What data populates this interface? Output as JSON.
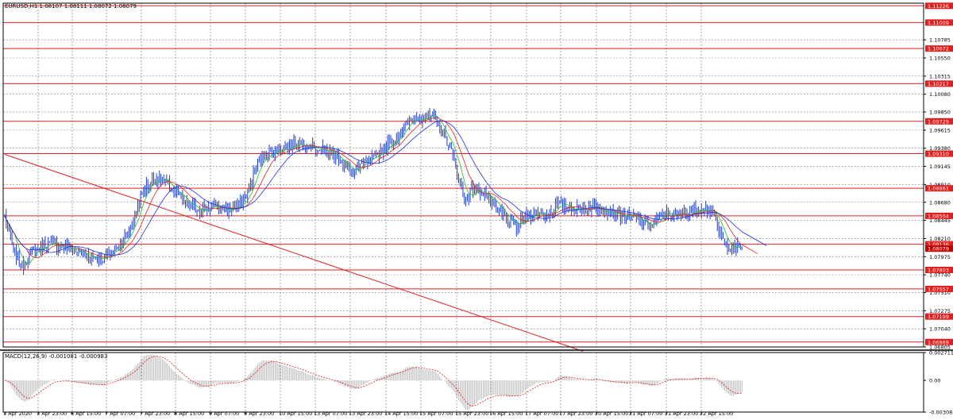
{
  "window": {
    "header": "EURUSD,H1  1.08107 1.08111 1.08072 1.08079",
    "macd_header": "MACD(12,26,9) -0.001081 -0.000983"
  },
  "colors": {
    "background": "#ffffff",
    "grid": "#c0c0c0",
    "candles": "#1f3fd0",
    "level_lines": "#e02020",
    "level_tags": "#e02020",
    "current_price_tag": "#c00000",
    "ma_green": "#22c022",
    "ma_red": "#e02020",
    "ma_blue": "#2030e0",
    "macd_hist": "#b0b0b0",
    "macd_signal": "#e02020"
  },
  "chart_data": [
    {
      "type": "candlestick",
      "symbol": "EURUSD",
      "timeframe": "H1",
      "ylim": [
        1.06805,
        1.1126
      ],
      "x_tick_labels": [
        "3 Apr 2020",
        "3 Apr 23:00",
        "6 Apr 15:00",
        "7 Apr 07:00",
        "7 Apr 23:00",
        "8 Apr 15:00",
        "9 Apr 07:00",
        "9 Apr 23:00",
        "10 Apr 15:00",
        "13 Apr 07:00",
        "13 Apr 23:00",
        "14 Apr 15:00",
        "15 Apr 07:00",
        "15 Apr 23:00",
        "16 Apr 15:00",
        "17 Apr 07:00",
        "17 Apr 23:00",
        "20 Apr 15:00",
        "21 Apr 07:00",
        "21 Apr 23:00",
        "22 Apr 15:00"
      ],
      "y_tick_labels": [
        "1.10785",
        "1.10550",
        "1.10315",
        "1.10080",
        "1.09850",
        "1.09615",
        "1.09380",
        "1.09145",
        "1.08910",
        "1.08680",
        "1.08445",
        "1.08210",
        "1.07975",
        "1.07740",
        "1.07510",
        "1.07275",
        "1.07040",
        "1.06805"
      ],
      "level_lines": [
        "1.11226",
        "1.11009",
        "1.10672",
        "1.10217",
        "1.09729",
        "1.09310",
        "1.08861",
        "1.08504",
        "1.08136",
        "1.07803",
        "1.07557",
        "1.07199",
        "1.06869"
      ],
      "current_price": "1.08079",
      "trend_line": {
        "from": {
          "bar": 0,
          "price": 1.093
        },
        "to": {
          "bar": 400,
          "price": 1.0675
        }
      },
      "price_path": [
        [
          0,
          1.085
        ],
        [
          6,
          1.0805
        ],
        [
          12,
          1.0785
        ],
        [
          20,
          1.0805
        ],
        [
          30,
          1.0815
        ],
        [
          42,
          1.081
        ],
        [
          55,
          1.08
        ],
        [
          68,
          1.0795
        ],
        [
          78,
          1.081
        ],
        [
          86,
          1.083
        ],
        [
          96,
          1.0885
        ],
        [
          104,
          1.09
        ],
        [
          110,
          1.0895
        ],
        [
          118,
          1.088
        ],
        [
          126,
          1.0865
        ],
        [
          134,
          1.0858
        ],
        [
          144,
          1.0863
        ],
        [
          154,
          1.0858
        ],
        [
          162,
          1.0862
        ],
        [
          168,
          1.088
        ],
        [
          174,
          1.0915
        ],
        [
          180,
          1.093
        ],
        [
          188,
          1.0935
        ],
        [
          196,
          1.094
        ],
        [
          204,
          1.0945
        ],
        [
          212,
          1.0942
        ],
        [
          220,
          1.0935
        ],
        [
          228,
          1.093
        ],
        [
          234,
          1.092
        ],
        [
          240,
          1.0905
        ],
        [
          248,
          1.0918
        ],
        [
          256,
          1.0925
        ],
        [
          262,
          1.0938
        ],
        [
          270,
          1.095
        ],
        [
          276,
          1.0965
        ],
        [
          282,
          1.0975
        ],
        [
          290,
          1.098
        ],
        [
          296,
          1.0978
        ],
        [
          302,
          1.0962
        ],
        [
          308,
          1.094
        ],
        [
          314,
          1.09
        ],
        [
          318,
          1.087
        ],
        [
          324,
          1.0885
        ],
        [
          332,
          1.088
        ],
        [
          340,
          1.086
        ],
        [
          348,
          1.0845
        ],
        [
          354,
          1.0835
        ],
        [
          360,
          1.0848
        ],
        [
          366,
          1.0855
        ],
        [
          374,
          1.085
        ],
        [
          382,
          1.0865
        ],
        [
          390,
          1.0862
        ],
        [
          398,
          1.0858
        ],
        [
          406,
          1.0863
        ],
        [
          414,
          1.086
        ],
        [
          420,
          1.0855
        ],
        [
          428,
          1.085
        ],
        [
          436,
          1.0848
        ],
        [
          442,
          1.084
        ],
        [
          448,
          1.0838
        ],
        [
          456,
          1.0855
        ],
        [
          464,
          1.085
        ],
        [
          470,
          1.0852
        ],
        [
          478,
          1.0858
        ],
        [
          484,
          1.0862
        ],
        [
          490,
          1.0855
        ],
        [
          494,
          1.083
        ],
        [
          498,
          1.0815
        ],
        [
          504,
          1.081
        ],
        [
          510,
          1.0808
        ]
      ]
    },
    {
      "type": "histogram",
      "name": "MACD(12,26,9)",
      "ylim": [
        -0.00308,
        0.002711
      ],
      "y_tick_labels": [
        "0.002711",
        "0.00",
        "-0.003083"
      ],
      "main": -0.001081,
      "signal": -0.000983
    }
  ]
}
